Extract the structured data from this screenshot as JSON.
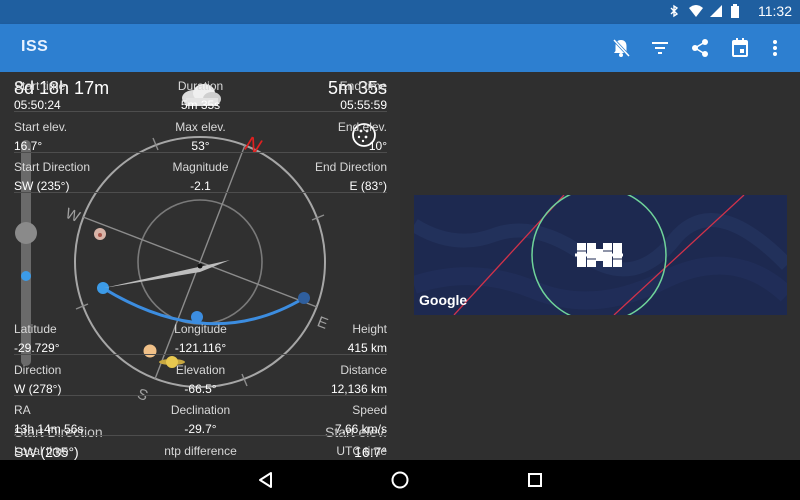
{
  "status_bar": {
    "time": "11:32",
    "icons": [
      "bluetooth-icon",
      "wifi-icon",
      "cell-signal-icon",
      "battery-icon"
    ]
  },
  "app_bar": {
    "title": "ISS",
    "actions": [
      "notifications-off-icon",
      "filter-icon",
      "share-icon",
      "calendar-icon",
      "more-vert-icon"
    ]
  },
  "left_panel": {
    "countdown": "8d 18h 17m",
    "duration": "5m 35s",
    "compass": {
      "north": "N",
      "west": "W",
      "east": "E",
      "south": "S"
    },
    "bottom": {
      "start_direction_label": "Start Direction",
      "start_direction_value": "SW (235°)",
      "start_elev_label": "Start elev.",
      "start_elev_value": "16.7°"
    }
  },
  "pass_info": [
    {
      "labels": [
        "Start time",
        "Duration",
        "End time"
      ],
      "values": [
        "05:50:24",
        "5m 35s",
        "05:55:59"
      ]
    },
    {
      "labels": [
        "Start elev.",
        "Max elev.",
        "End elev."
      ],
      "values": [
        "16.7°",
        "53°",
        "10°"
      ]
    },
    {
      "labels": [
        "Start Direction",
        "Magnitude",
        "End Direction"
      ],
      "values": [
        "SW (235°)",
        "-2.1",
        "E (83°)"
      ]
    }
  ],
  "map": {
    "attribution": "Google"
  },
  "position_info": [
    {
      "labels": [
        "Latitude",
        "Longitude",
        "Height"
      ],
      "values": [
        "-29.729°",
        "-121.116°",
        "415 km"
      ]
    },
    {
      "labels": [
        "Direction",
        "Elevation",
        "Distance"
      ],
      "values": [
        "W (278°)",
        "-66.5°",
        "12,136 km"
      ]
    },
    {
      "labels": [
        "RA",
        "Declination",
        "Speed"
      ],
      "values": [
        "13h 14m 56s",
        "-29.7°",
        "7.66 km/s"
      ]
    },
    {
      "labels": [
        "Local time",
        "ntp difference",
        "UTC time"
      ],
      "values": [
        "",
        "",
        ""
      ]
    }
  ],
  "colors": {
    "app_bar": "#2d7fd0",
    "status_bar": "#1f5fa0",
    "pass_track": "#3c8de0",
    "north": "#e02020"
  }
}
